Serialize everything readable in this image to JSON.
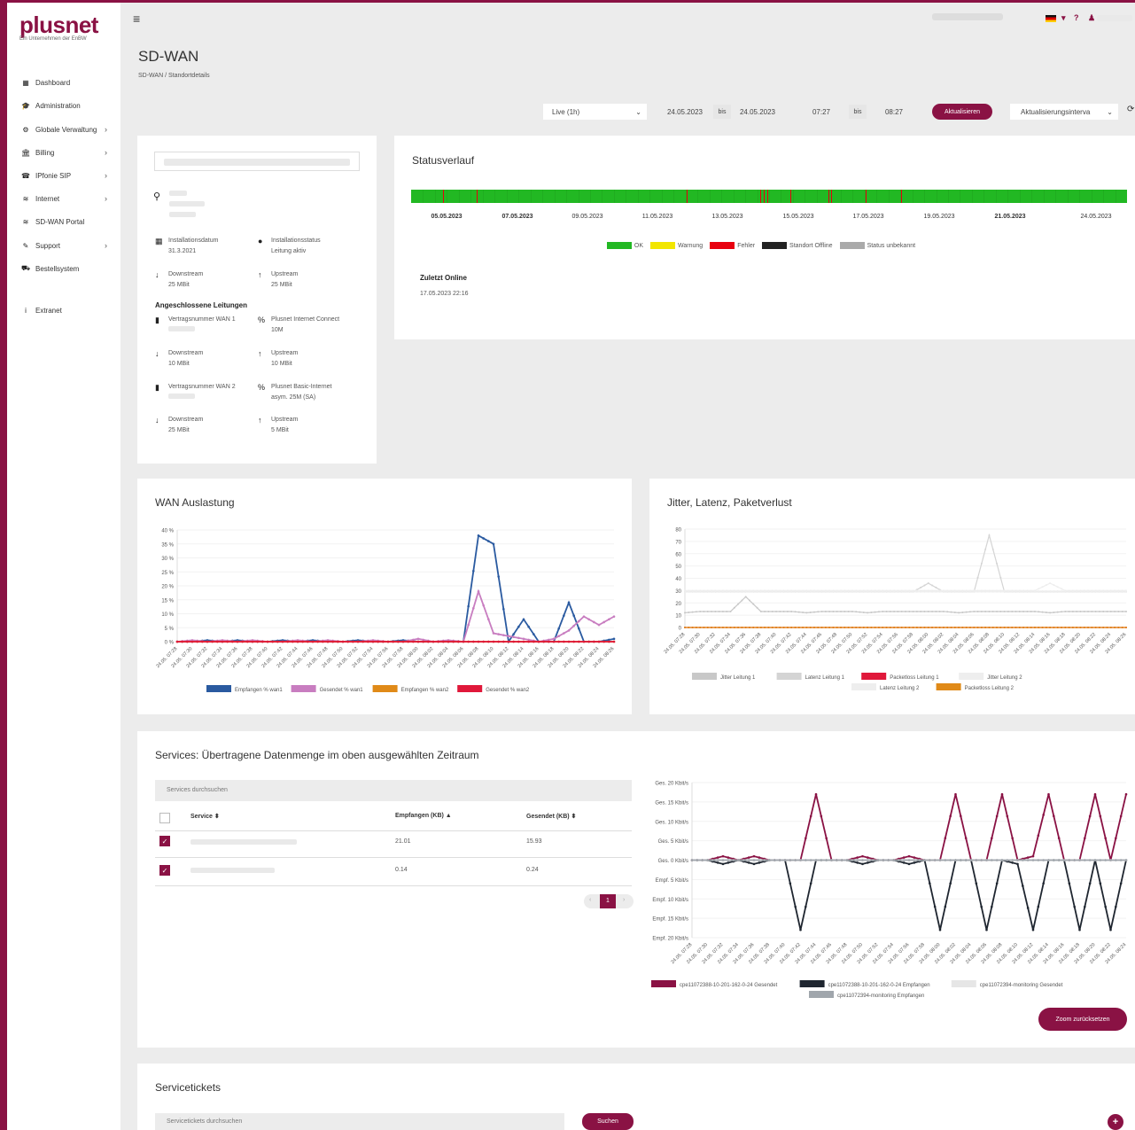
{
  "brand": {
    "logo": "plusnet",
    "subtitle": "Ein Unternehmen der EnBW"
  },
  "sidebar": {
    "items": [
      {
        "label": "Dashboard",
        "icon": "dashboard-icon",
        "glyph": "▦",
        "chevron": ""
      },
      {
        "label": "Administration",
        "icon": "graduation-cap-icon",
        "glyph": "🎓",
        "chevron": ""
      },
      {
        "label": "Globale Verwaltung",
        "icon": "gears-icon",
        "glyph": "⚙",
        "chevron": "›"
      },
      {
        "label": "Billing",
        "icon": "bank-icon",
        "glyph": "🏛",
        "chevron": "›"
      },
      {
        "label": "IPfonie SIP",
        "icon": "phone-icon",
        "glyph": "☎",
        "chevron": "›"
      },
      {
        "label": "Internet",
        "icon": "wifi-icon",
        "glyph": "≋",
        "chevron": "›"
      },
      {
        "label": "SD-WAN Portal",
        "icon": "wifi-icon",
        "glyph": "≋",
        "chevron": ""
      },
      {
        "label": "Support",
        "icon": "wrench-icon",
        "glyph": "✎",
        "chevron": "›"
      },
      {
        "label": "Bestellsystem",
        "icon": "cart-icon",
        "glyph": "⛟",
        "chevron": ""
      },
      {
        "label": "Extranet",
        "icon": "info-icon",
        "glyph": "i",
        "chevron": ""
      }
    ]
  },
  "header": {
    "menu_glyph": "≡",
    "help_glyph": "?",
    "user_glyph": "♟"
  },
  "page": {
    "title": "SD-WAN",
    "breadcrumb": "SD-WAN  /  Standortdetails"
  },
  "filters": {
    "range": "Live (1h)",
    "range_chevron": "⌄",
    "date_from": "24.05.2023",
    "bis1": "bis",
    "date_to": "24.05.2023",
    "time_from": "07:27",
    "bis2": "bis",
    "time_to": "08:27",
    "update_button": "Aktualisieren",
    "interval": "Aktualisierungsinterva",
    "interval_chevron": "⌄"
  },
  "site": {
    "install_date_label": "Installationsdatum",
    "install_date": "31.3.2021",
    "install_status_label": "Installationsstatus",
    "install_status": "Leitung aktiv",
    "downstream_label": "Downstream",
    "downstream": "25 MBit",
    "upstream_label": "Upstream",
    "upstream": "25 MBit",
    "lines_heading": "Angeschlossene Leitungen",
    "wan1_label": "Vertragsnummer WAN 1",
    "wan1_product": "Plusnet Internet Connect",
    "wan1_product2": "10M",
    "wan1_down_label": "Downstream",
    "wan1_down": "10 MBit",
    "wan1_up_label": "Upstream",
    "wan1_up": "10 MBit",
    "wan2_label": "Vertragsnummer WAN 2",
    "wan2_product": "Plusnet Basic-Internet",
    "wan2_product2": "asym. 25M (SA)",
    "wan2_down_label": "Downstream",
    "wan2_down": "25 MBit",
    "wan2_up_label": "Upstream",
    "wan2_up": "5 MBit"
  },
  "status": {
    "title": "Statusverlauf",
    "dates": [
      "05.05.2023",
      "07.05.2023",
      "09.05.2023",
      "11.05.2023",
      "13.05.2023",
      "15.05.2023",
      "17.05.2023",
      "19.05.2023",
      "21.05.2023",
      "24.05.2023"
    ],
    "bold_dates": [
      0,
      1,
      8
    ],
    "error_marks": [
      0.045,
      0.092,
      0.385,
      0.488,
      0.492,
      0.497,
      0.53,
      0.583,
      0.587,
      0.635,
      0.684
    ],
    "legend": [
      {
        "label": "OK",
        "color": "#22b823"
      },
      {
        "label": "Warnung",
        "color": "#f2e600"
      },
      {
        "label": "Fehler",
        "color": "#e8000f"
      },
      {
        "label": "Standort Offline",
        "color": "#222222"
      },
      {
        "label": "Status unbekannt",
        "color": "#aaaaaa"
      }
    ],
    "last_online_label": "Zuletzt Online",
    "last_online": "17.05.2023 22:16"
  },
  "wan_chart": {
    "title": "WAN Auslastung",
    "chart_data": {
      "type": "line",
      "y_ticks": [
        "40 %",
        "35 %",
        "30 %",
        "25 %",
        "20 %",
        "15 %",
        "10 %",
        "5 %",
        "0 %"
      ],
      "ylim": [
        0,
        40
      ],
      "x_labels": [
        "24.05. 07:28",
        "24.05. 07:30",
        "24.05. 07:32",
        "24.05. 07:34",
        "24.05. 07:36",
        "24.05. 07:38",
        "24.05. 07:40",
        "24.05. 07:42",
        "24.05. 07:44",
        "24.05. 07:46",
        "24.05. 07:48",
        "24.05. 07:50",
        "24.05. 07:52",
        "24.05. 07:54",
        "24.05. 07:56",
        "24.05. 07:58",
        "24.05. 08:00",
        "24.05. 08:02",
        "24.05. 08:04",
        "24.05. 08:06",
        "24.05. 08:08",
        "24.05. 08:10",
        "24.05. 08:12",
        "24.05. 08:14",
        "24.05. 08:16",
        "24.05. 08:18",
        "24.05. 08:20",
        "24.05. 08:22",
        "24.05. 08:24",
        "24.05. 08:26"
      ],
      "series": [
        {
          "name": "Empfangen % wan1",
          "color": "#2a5aa0",
          "values": [
            0,
            0,
            0.5,
            0,
            0.5,
            0,
            0,
            0.5,
            0,
            0.5,
            0,
            0,
            0.5,
            0,
            0,
            0.5,
            0,
            0,
            0,
            0,
            38,
            35,
            0,
            8,
            0,
            0,
            14,
            0,
            0,
            1
          ]
        },
        {
          "name": "Gesendet % wan1",
          "color": "#c87dc0",
          "values": [
            0,
            0.5,
            0,
            0.5,
            0,
            0.5,
            0,
            0,
            0.5,
            0,
            0.5,
            0,
            0,
            0.5,
            0,
            0,
            1,
            0,
            0.5,
            0,
            18,
            3,
            2,
            1,
            0,
            1,
            4,
            9,
            6,
            9
          ]
        },
        {
          "name": "Empfangen % wan2",
          "color": "#e08a18",
          "values": [
            0,
            0,
            0,
            0,
            0,
            0,
            0,
            0,
            0,
            0,
            0,
            0,
            0,
            0,
            0,
            0,
            0,
            0,
            0,
            0,
            0,
            0,
            0,
            0,
            0,
            0,
            0,
            0,
            0,
            0
          ]
        },
        {
          "name": "Gesendet % wan2",
          "color": "#e0183a",
          "values": [
            0,
            0,
            0,
            0,
            0,
            0,
            0,
            0,
            0,
            0,
            0,
            0,
            0,
            0,
            0,
            0,
            0,
            0,
            0,
            0,
            0,
            0,
            0,
            0,
            0,
            0,
            0,
            0,
            0,
            0
          ]
        }
      ]
    }
  },
  "jitter_chart": {
    "title": "Jitter, Latenz, Paketverlust",
    "chart_data": {
      "type": "line",
      "y_ticks": [
        "80",
        "70",
        "60",
        "50",
        "40",
        "30",
        "20",
        "10",
        "0"
      ],
      "ylim": [
        0,
        80
      ],
      "x_labels": [
        "24.05. 07:28",
        "24.05. 07:30",
        "24.05. 07:32",
        "24.05. 07:34",
        "24.05. 07:36",
        "24.05. 07:38",
        "24.05. 07:40",
        "24.05. 07:42",
        "24.05. 07:44",
        "24.05. 07:46",
        "24.05. 07:48",
        "24.05. 07:50",
        "24.05. 07:52",
        "24.05. 07:54",
        "24.05. 07:56",
        "24.05. 07:58",
        "24.05. 08:00",
        "24.05. 08:02",
        "24.05. 08:04",
        "24.05. 08:06",
        "24.05. 08:08",
        "24.05. 08:10",
        "24.05. 08:12",
        "24.05. 08:14",
        "24.05. 08:16",
        "24.05. 08:18",
        "24.05. 08:20",
        "24.05. 08:22",
        "24.05. 08:24",
        "24.05. 08:26"
      ],
      "series": [
        {
          "name": "Jitter Leitung 1",
          "color": "#c8c8c8",
          "values": [
            12,
            13,
            13,
            13,
            25,
            13,
            13,
            13,
            12,
            13,
            13,
            13,
            12,
            13,
            13,
            13,
            13,
            13,
            12,
            13,
            13,
            13,
            13,
            13,
            12,
            13,
            13,
            13,
            13,
            13
          ]
        },
        {
          "name": "Latenz Leitung 1",
          "color": "#d4d4d4",
          "values": [
            29,
            29,
            29,
            29,
            29,
            29,
            29,
            29,
            29,
            29,
            29,
            29,
            29,
            29,
            29,
            29,
            36,
            29,
            29,
            29,
            75,
            29,
            29,
            29,
            29,
            29,
            29,
            29,
            29,
            29
          ]
        },
        {
          "name": "Packetloss Leitung 1",
          "color": "#e0183a",
          "values": [
            0,
            0,
            0,
            0,
            0,
            0,
            0,
            0,
            0,
            0,
            0,
            0,
            0,
            0,
            0,
            0,
            0,
            0,
            0,
            0,
            0,
            0,
            0,
            0,
            0,
            0,
            0,
            0,
            0,
            0
          ]
        },
        {
          "name": "Jitter Leitung 2",
          "color": "#eeeeee",
          "values": [
            29,
            29,
            29,
            29,
            29,
            29,
            29,
            29,
            29,
            29,
            29,
            29,
            29,
            29,
            29,
            29,
            29,
            29,
            29,
            29,
            29,
            29,
            29,
            29,
            29,
            29,
            29,
            29,
            29,
            29
          ]
        },
        {
          "name": "Latenz Leitung 2",
          "color": "#eeeeee",
          "values": [
            30,
            30,
            30,
            30,
            30,
            30,
            30,
            30,
            30,
            30,
            30,
            30,
            30,
            30,
            30,
            30,
            30,
            30,
            30,
            30,
            30,
            30,
            30,
            30,
            36,
            30,
            30,
            30,
            30,
            30
          ]
        },
        {
          "name": "Packetloss Leitung 2",
          "color": "#e08a18",
          "values": [
            0,
            0,
            0,
            0,
            0,
            0,
            0,
            0,
            0,
            0,
            0,
            0,
            0,
            0,
            0,
            0,
            0,
            0,
            0,
            0,
            0,
            0,
            0,
            0,
            0,
            0,
            0,
            0,
            0,
            0
          ]
        }
      ]
    }
  },
  "services": {
    "title": "Services: Übertragene Datenmenge im oben ausgewählten Zeitraum",
    "search_placeholder": "Services durchsuchen",
    "columns": [
      "Service ⬍",
      "Empfangen (KB) ▲",
      "Gesendet (KB) ⬍"
    ],
    "rows": [
      {
        "received": "21.01",
        "sent": "15.93"
      },
      {
        "received": "0.14",
        "sent": "0.24"
      }
    ],
    "page": "1",
    "prev": "‹",
    "next": "›",
    "zoom_reset": "Zoom zurücksetzen",
    "chart_data": {
      "type": "line",
      "y_ticks": [
        "Ges. 20 Kbit/s",
        "Ges. 15 Kbit/s",
        "Ges. 10 Kbit/s",
        "Ges. 5 Kbit/s",
        "Ges. 0 Kbit/s",
        "Empf. 5 Kbit/s",
        "Empf. 10 Kbit/s",
        "Empf. 15 Kbit/s",
        "Empf. 20 Kbit/s"
      ],
      "ylim": [
        -20,
        20
      ],
      "x_labels": [
        "24.05. 07:28",
        "24.05. 07:30",
        "24.05. 07:32",
        "24.05. 07:34",
        "24.05. 07:36",
        "24.05. 07:38",
        "24.05. 07:40",
        "24.05. 07:42",
        "24.05. 07:44",
        "24.05. 07:46",
        "24.05. 07:48",
        "24.05. 07:50",
        "24.05. 07:52",
        "24.05. 07:54",
        "24.05. 07:56",
        "24.05. 07:58",
        "24.05. 08:00",
        "24.05. 08:02",
        "24.05. 08:04",
        "24.05. 08:06",
        "24.05. 08:08",
        "24.05. 08:10",
        "24.05. 08:12",
        "24.05. 08:14",
        "24.05. 08:16",
        "24.05. 08:18",
        "24.05. 08:20",
        "24.05. 08:22",
        "24.05. 08:24"
      ],
      "series": [
        {
          "name": "cpe11072388-10-201-162-0-24 Gesendet",
          "color": "#8a1244",
          "values": [
            0,
            0,
            1,
            0,
            1,
            0,
            0,
            0,
            17,
            0,
            0,
            1,
            0,
            0,
            1,
            0,
            0,
            17,
            0,
            0,
            17,
            0,
            1,
            17,
            0,
            0,
            17,
            0,
            17
          ]
        },
        {
          "name": "cpe11072388-10-201-162-0-24 Empfangen",
          "color": "#1f2630",
          "values": [
            0,
            0,
            -1,
            0,
            -1,
            0,
            0,
            -18,
            0,
            0,
            0,
            -1,
            0,
            0,
            -1,
            0,
            -18,
            0,
            0,
            -18,
            0,
            -1,
            -18,
            0,
            0,
            -18,
            0,
            -18,
            0
          ]
        },
        {
          "name": "cpe11072394-monitoring Gesendet",
          "color": "#e6e6e6",
          "values": [
            0,
            0,
            0,
            0,
            0,
            0,
            0,
            0,
            0,
            0,
            0,
            0,
            0,
            0,
            0,
            0,
            0,
            0,
            0,
            0,
            0,
            0,
            0,
            0,
            0,
            0,
            0,
            0,
            0
          ]
        },
        {
          "name": "cpe11072394-monitoring Empfangen",
          "color": "#a0a6ac",
          "values": [
            0,
            0,
            0,
            0,
            0,
            0,
            0,
            0,
            0,
            0,
            0,
            0,
            0,
            0,
            0,
            0,
            0,
            0,
            0,
            0,
            0,
            0,
            0,
            0,
            0,
            0,
            0,
            0,
            0
          ]
        }
      ]
    }
  },
  "tickets": {
    "title": "Servicetickets",
    "search_placeholder": "Servicetickets durchsuchen",
    "search_button": "Suchen",
    "add_glyph": "+"
  }
}
